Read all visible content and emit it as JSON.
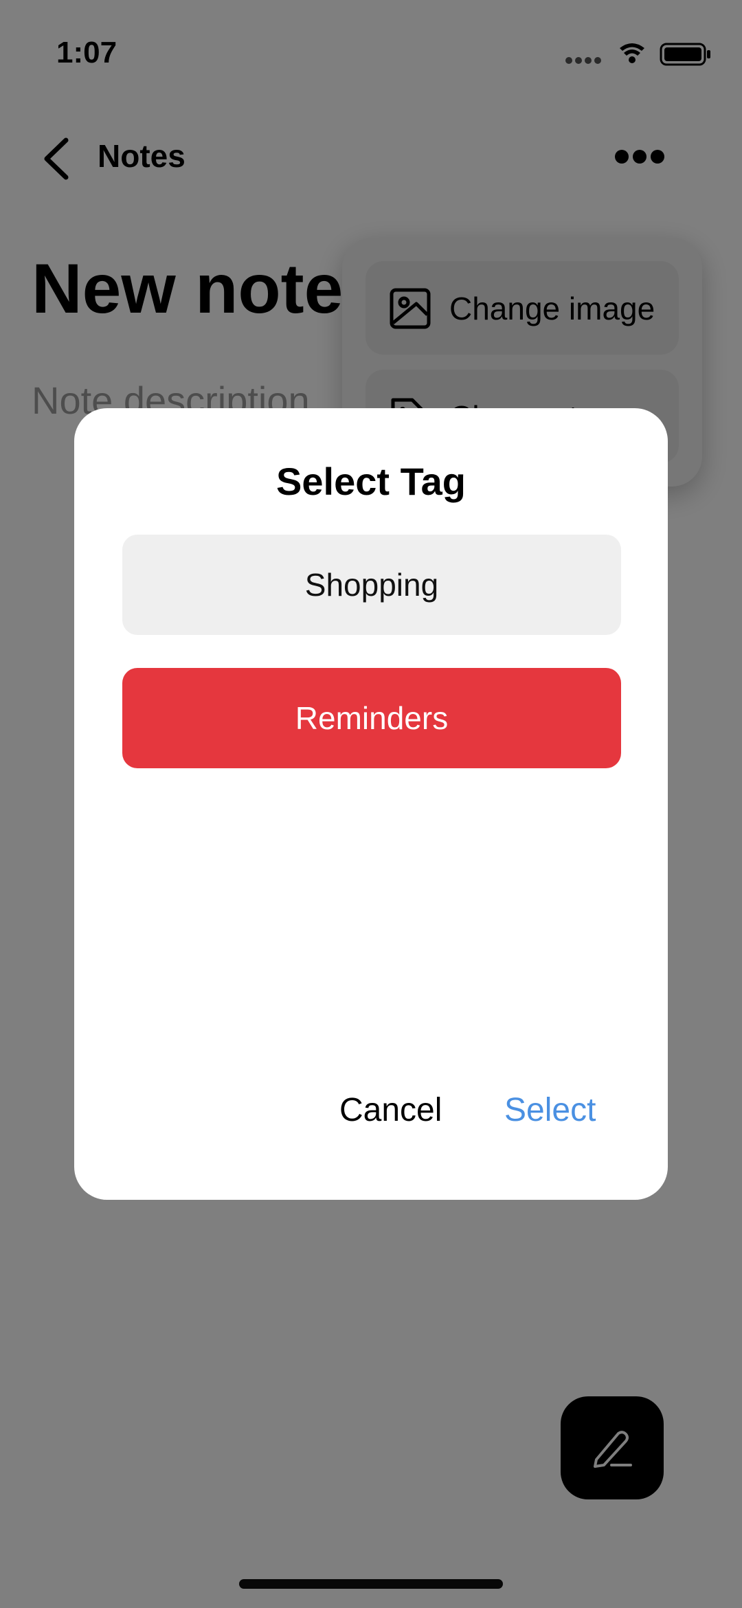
{
  "status_bar": {
    "time": "1:07"
  },
  "nav": {
    "back_label": "Notes"
  },
  "note": {
    "title": "New note",
    "description_placeholder": "Note description"
  },
  "menu": {
    "items": [
      {
        "label": "Change image",
        "icon": "image-icon"
      },
      {
        "label": "Change tag",
        "icon": "tag-icon"
      }
    ]
  },
  "dialog": {
    "title": "Select Tag",
    "tags": [
      {
        "label": "Shopping",
        "selected": false
      },
      {
        "label": "Reminders",
        "selected": true,
        "color": "#e5373e"
      }
    ],
    "cancel_label": "Cancel",
    "select_label": "Select",
    "select_color": "#4a90e2"
  },
  "fab": {
    "icon": "pencil-icon"
  }
}
